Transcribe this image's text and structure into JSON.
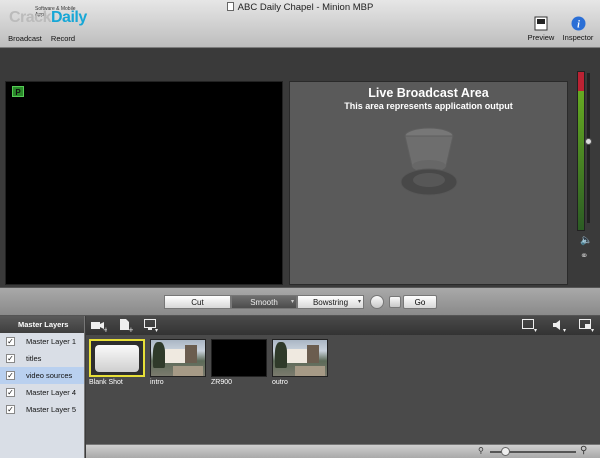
{
  "window": {
    "title": "ABC Daily Chapel - Minion MBP"
  },
  "watermark": {
    "text_a": "Crack",
    "text_b": "Daily",
    "caption": "Software & Mobile Apps"
  },
  "toolbar": {
    "broadcast_label": "Broadcast",
    "record_label": "Record",
    "preview_label": "Preview",
    "inspector_label": "Inspector"
  },
  "preview": {
    "badge": "P"
  },
  "live": {
    "title": "Live Broadcast Area",
    "subtitle": "This area represents application output"
  },
  "audio": {
    "volume_level": 0.45
  },
  "transitions": {
    "cut_label": "Cut",
    "smooth_label": "Smooth",
    "bowstring_label": "Bowstring",
    "go_label": "Go",
    "selected": "Smooth"
  },
  "sidebar": {
    "header": "Master Layers",
    "layers": [
      {
        "label": "Master Layer 1",
        "checked": true
      },
      {
        "label": "titles",
        "checked": true
      },
      {
        "label": "video sources",
        "checked": true,
        "selected": true
      },
      {
        "label": "Master Layer 4",
        "checked": true
      },
      {
        "label": "Master Layer 5",
        "checked": true
      }
    ]
  },
  "sources": {
    "items": [
      {
        "label": "Blank Shot",
        "kind": "blank",
        "selected": true
      },
      {
        "label": "intro",
        "kind": "image"
      },
      {
        "label": "ZR900",
        "kind": "black"
      },
      {
        "label": "outro",
        "kind": "image"
      }
    ]
  },
  "zoom": {
    "level": 0.17
  },
  "icons": {
    "add_camera": "video-camera-add-icon",
    "add_media": "document-add-icon",
    "add_display": "monitor-add-icon",
    "aspect": "aspect-ratio-icon",
    "speaker": "speaker-icon",
    "layout": "layout-icon"
  }
}
